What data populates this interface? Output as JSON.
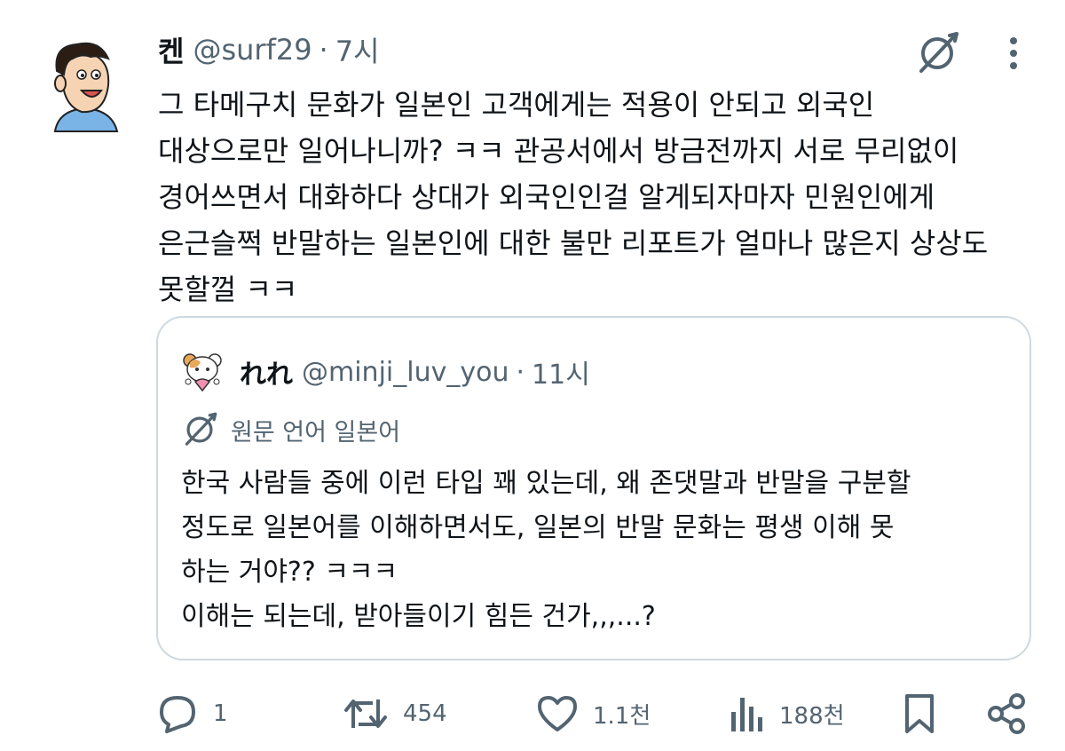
{
  "post": {
    "author_name": "켄",
    "handle": "@surf29",
    "separator": "·",
    "time": "7시",
    "lines": [
      "그 타메구치 문화가 일본인 고객에게는 적용이 안되고 외국인",
      "대상으로만 일어나니까? ㅋㅋ 관공서에서 방금전까지 서로 무리없이",
      "경어쓰면서 대화하다 상대가 외국인인걸 알게되자마자 민원인에게",
      "은근슬쩍 반말하는 일본인에 대한 불만 리포트가 얼마나 많은지 상상도",
      "못할껄 ㅋㅋ"
    ]
  },
  "quote": {
    "author_name": "れれ",
    "handle": "@minji_luv_you",
    "separator": "·",
    "time": "11시",
    "language_note": "원문 언어 일본어",
    "lines": [
      "한국 사람들 중에 이런 타입 꽤 있는데, 왜 존댓말과 반말을 구분할",
      "정도로 일본어를 이해하면서도, 일본의 반말 문화는 평생 이해 못",
      "하는 거야?? ㅋㅋㅋ",
      "이해는 되는데, 받아들이기 힘든 건가,,,...?"
    ]
  },
  "actions": {
    "reply_count": "1",
    "repost_count": "454",
    "like_count": "1.1천",
    "views_count": "188천"
  },
  "icons": {
    "translate": "translate-icon",
    "more": "more-vertical-icon",
    "reply": "reply-icon",
    "repost": "repost-icon",
    "like": "heart-icon",
    "views": "views-icon",
    "bookmark": "bookmark-icon",
    "share": "share-icon"
  },
  "colors": {
    "text": "#0f1419",
    "secondary": "#536471",
    "border": "#cfd9de"
  }
}
